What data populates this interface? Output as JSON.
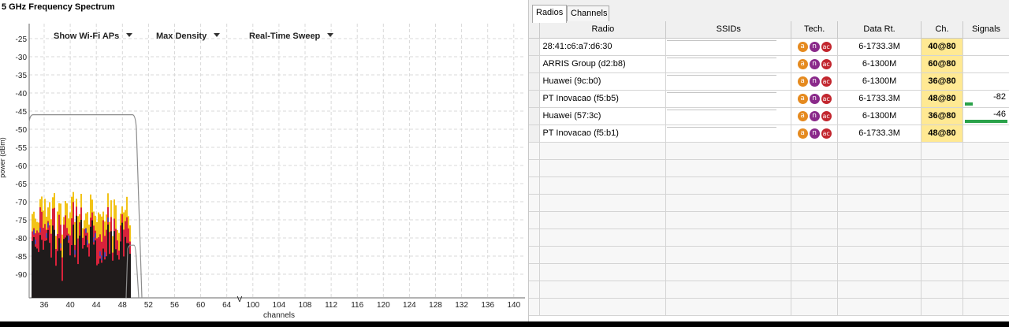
{
  "spectrum": {
    "title": "5 GHz Frequency Spectrum",
    "controls": [
      "Show Wi-Fi APs",
      "Max Density",
      "Real-Time Sweep"
    ],
    "y_axis_label": "power (dBm)",
    "x_axis_label": "channels",
    "y_ticks": [
      "-25",
      "-30",
      "-35",
      "-40",
      "-45",
      "-50",
      "-55",
      "-60",
      "-65",
      "-70",
      "-75",
      "-80",
      "-85",
      "-90"
    ],
    "x_ticks": [
      "36",
      "40",
      "44",
      "48",
      "52",
      "56",
      "60",
      "64",
      "100",
      "104",
      "108",
      "112",
      "116",
      "120",
      "124",
      "128",
      "132",
      "136",
      "140"
    ],
    "axis_break_mark": "V",
    "colors": {
      "grid": "#d9d9d9",
      "density_low": "#1f1b1b",
      "density_mid": "#d9223b",
      "density_high": "#f2c318",
      "density_accent": "#5a3ea8",
      "envelope": "#8c8c8c"
    }
  },
  "radios_panel": {
    "tabs": [
      "Radios",
      "Channels"
    ],
    "active_tab": "Radios",
    "columns": [
      "Radio",
      "SSIDs",
      "Tech.",
      "Data Rt.",
      "Ch.",
      "Signals"
    ],
    "rows": [
      {
        "radio": "28:41:c6:a7:d6:30",
        "ssid": "",
        "tech": [
          "a",
          "n",
          "ac"
        ],
        "data_rate": "6-1733.3M",
        "channel": "40@80",
        "signal": ""
      },
      {
        "radio": "ARRIS Group (d2:b8)",
        "ssid": "",
        "tech": [
          "a",
          "n",
          "ac"
        ],
        "data_rate": "6-1300M",
        "channel": "60@80",
        "signal": ""
      },
      {
        "radio": "Huawei (9c:b0)",
        "ssid": "",
        "tech": [
          "a",
          "n",
          "ac"
        ],
        "data_rate": "6-1300M",
        "channel": "36@80",
        "signal": ""
      },
      {
        "radio": "PT Inovacao (f5:b5)",
        "ssid": "",
        "tech": [
          "a",
          "n",
          "ac"
        ],
        "data_rate": "6-1733.3M",
        "channel": "48@80",
        "signal": "-82"
      },
      {
        "radio": "Huawei (57:3c)",
        "ssid": "",
        "tech": [
          "a",
          "n",
          "ac"
        ],
        "data_rate": "6-1300M",
        "channel": "36@80",
        "signal": "-46"
      },
      {
        "radio": "PT Inovacao (f5:b1)",
        "ssid": "",
        "tech": [
          "a",
          "n",
          "ac"
        ],
        "data_rate": "6-1733.3M",
        "channel": "48@80",
        "signal": ""
      }
    ],
    "signal_levels_dbm": {
      "PT Inovacao (f5:b5)": -82,
      "Huawei (57:3c)": -46
    },
    "colors": {
      "channel_cell": "#ffe993",
      "tech_a": "#e58a1f",
      "tech_n": "#8a2a8a",
      "tech_ac": "#c2262e",
      "signal_bar": "#2aa24a"
    }
  }
}
